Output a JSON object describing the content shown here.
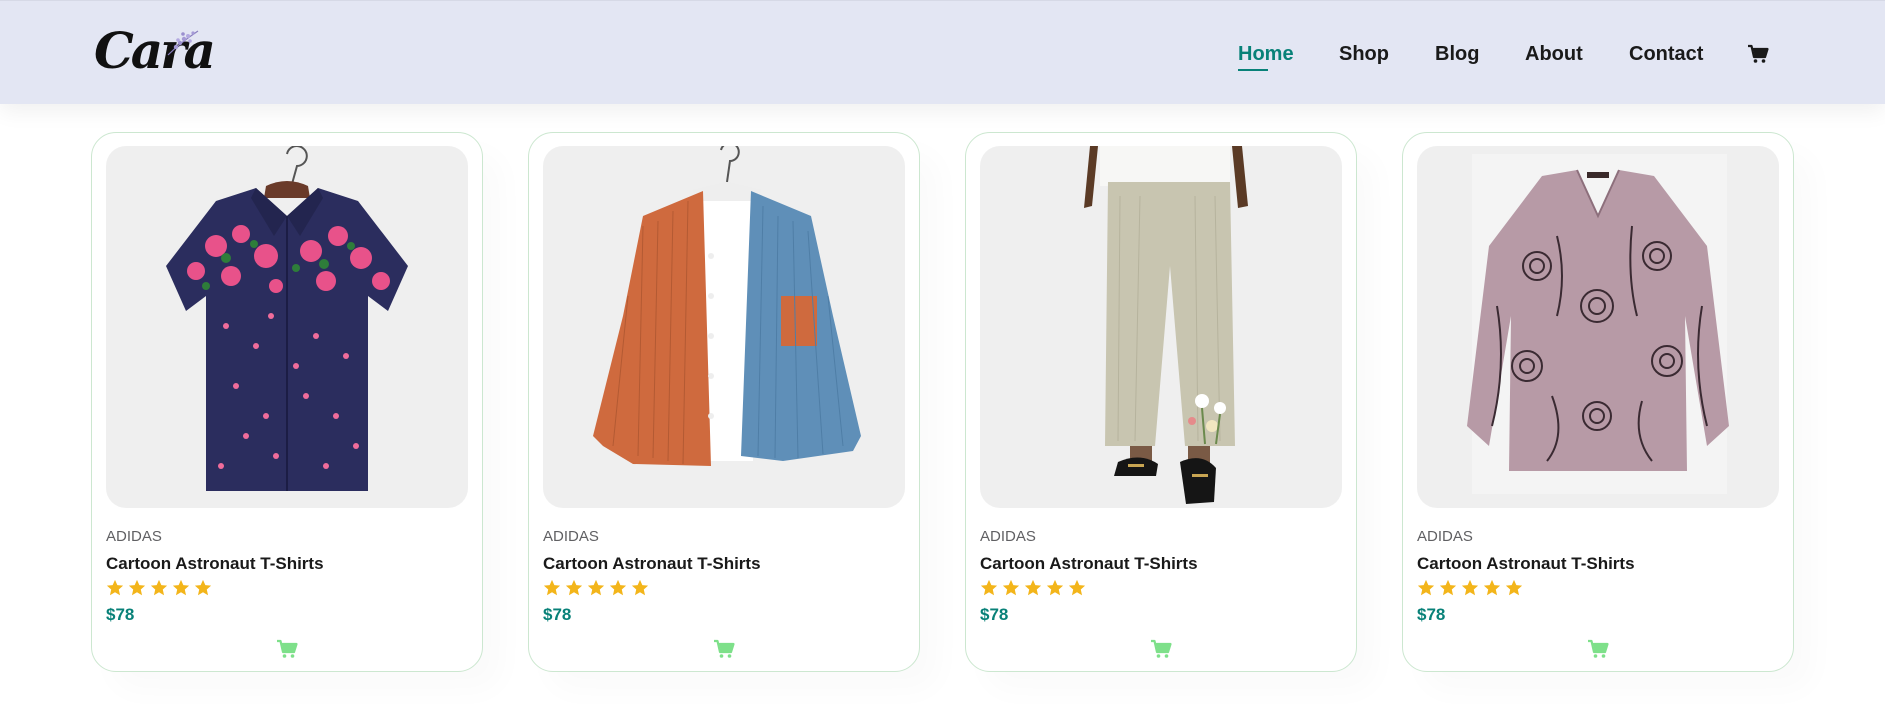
{
  "brand": {
    "logo_text": "Cara"
  },
  "nav": {
    "items": [
      {
        "label": "Home",
        "active": true
      },
      {
        "label": "Shop",
        "active": false
      },
      {
        "label": "Blog",
        "active": false
      },
      {
        "label": "About",
        "active": false
      },
      {
        "label": "Contact",
        "active": false
      }
    ],
    "cart_icon": "cart-icon"
  },
  "colors": {
    "header_bg": "#e3e6f3",
    "accent": "#088178",
    "star": "#f3b51a",
    "cart_button": "#7ee08a",
    "card_border": "#cce7d0"
  },
  "products": [
    {
      "image": "floral-shirt-image",
      "brand": "ADIDAS",
      "title": "Cartoon Astronaut T-Shirts",
      "rating": 5,
      "price": "$78",
      "cart_icon": "cart-icon"
    },
    {
      "image": "corduroy-shirt-image",
      "brand": "ADIDAS",
      "title": "Cartoon Astronaut T-Shirts",
      "rating": 5,
      "price": "$78",
      "cart_icon": "cart-icon"
    },
    {
      "image": "linen-pants-image",
      "brand": "ADIDAS",
      "title": "Cartoon Astronaut T-Shirts",
      "rating": 5,
      "price": "$78",
      "cart_icon": "cart-icon"
    },
    {
      "image": "printed-blouse-image",
      "brand": "ADIDAS",
      "title": "Cartoon Astronaut T-Shirts",
      "rating": 5,
      "price": "$78",
      "cart_icon": "cart-icon"
    }
  ]
}
